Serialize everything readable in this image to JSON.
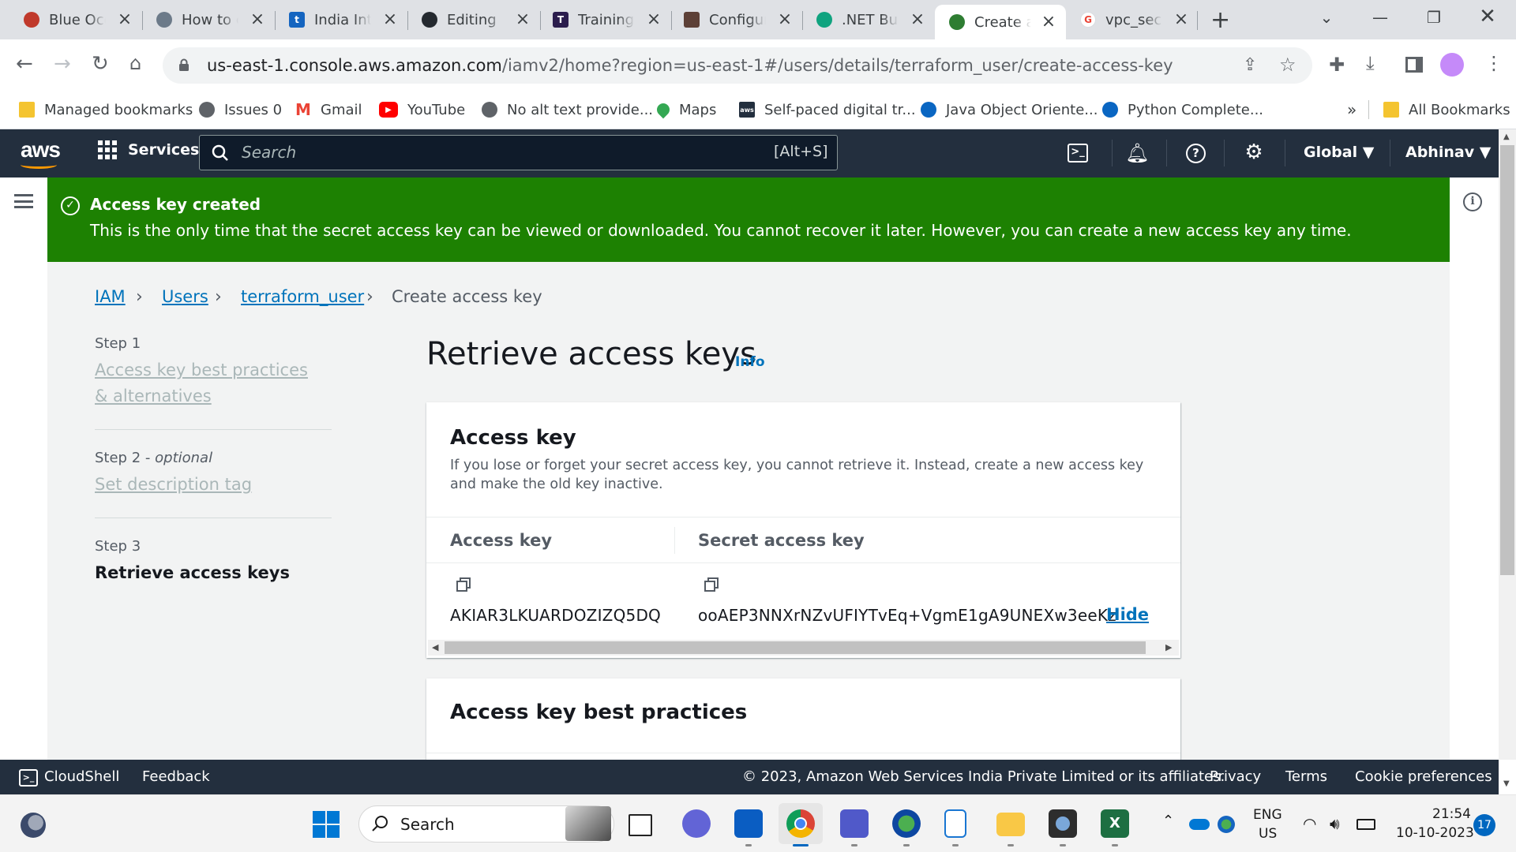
{
  "browser": {
    "tabs": [
      {
        "title": "Blue Ocean",
        "color": "#c0392b"
      },
      {
        "title": "How to create",
        "color": "#6c7a89"
      },
      {
        "title": "India Internet",
        "color": "#1565c0"
      },
      {
        "title": "Editing",
        "color": "#24292f"
      },
      {
        "title": "Training",
        "color": "#2b1d4d"
      },
      {
        "title": "Configure",
        "color": "#5d4037"
      },
      {
        "title": ".NET Build",
        "color": "#10a37f"
      },
      {
        "title": "Create access key",
        "color": "#2e7d32"
      },
      {
        "title": "vpc_security",
        "color": "#ea4335"
      }
    ],
    "new_tab": "+",
    "url_host": "us-east-1.console.aws.amazon.com",
    "url_path": "/iamv2/home?region=us-east-1#/users/details/terraform_user/create-access-key",
    "bookmarks": [
      {
        "label": "Managed bookmarks",
        "icon": "folder-icon"
      },
      {
        "label": "Issues 0",
        "icon": "globe-icon"
      },
      {
        "label": "Gmail",
        "icon": "gmail-icon"
      },
      {
        "label": "YouTube",
        "icon": "youtube-icon"
      },
      {
        "label": "No alt text provide...",
        "icon": "globe-icon"
      },
      {
        "label": "Maps",
        "icon": "maps-icon"
      },
      {
        "label": "Self-paced digital tr...",
        "icon": "aws-icon"
      },
      {
        "label": "Java Object Oriente...",
        "icon": "cloud-icon"
      },
      {
        "label": "Python Complete...",
        "icon": "cloud-icon"
      }
    ],
    "bookmarks_more": "»",
    "all_bookmarks": "All Bookmarks"
  },
  "aws_header": {
    "logo": "aws",
    "services": "Services",
    "search_placeholder": "Search",
    "search_shortcut": "[Alt+S]",
    "region": "Global ▼",
    "user": "Abhinav ▼"
  },
  "flash": {
    "title": "Access key created",
    "message": "This is the only time that the secret access key can be viewed or downloaded. You cannot recover it later. However, you can create a new access key any time.",
    "color": "#1d8102"
  },
  "breadcrumb": [
    "IAM",
    "Users",
    "terraform_user",
    "Create access key"
  ],
  "steps": [
    {
      "num": "Step 1",
      "label": "Access key best practices & alternatives"
    },
    {
      "num": "Step 2",
      "optional": "optional",
      "label": "Set description tag"
    },
    {
      "num": "Step 3",
      "label": "Retrieve access keys"
    }
  ],
  "main": {
    "title": "Retrieve access keys",
    "info": "Info",
    "access_key_card": {
      "title": "Access key",
      "description": "If you lose or forget your secret access key, you cannot retrieve it. Instead, create a new access key and make the old key inactive.",
      "col_access_key": "Access key",
      "col_secret": "Secret access key",
      "access_key_value": "AKIAR3LKUARDOZIZQ5DQ",
      "secret_value": "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",
      "hide": "Hide"
    },
    "best_practices_title": "Access key best practices"
  },
  "footer": {
    "cloudshell": "CloudShell",
    "feedback": "Feedback",
    "copyright": "© 2023, Amazon Web Services India Private Limited or its affiliates.",
    "privacy": "Privacy",
    "terms": "Terms",
    "cookies": "Cookie preferences"
  },
  "taskbar": {
    "search": "Search",
    "lang1": "ENG",
    "lang2": "US",
    "time": "21:54",
    "date": "10-10-2023",
    "notifications": "17"
  }
}
